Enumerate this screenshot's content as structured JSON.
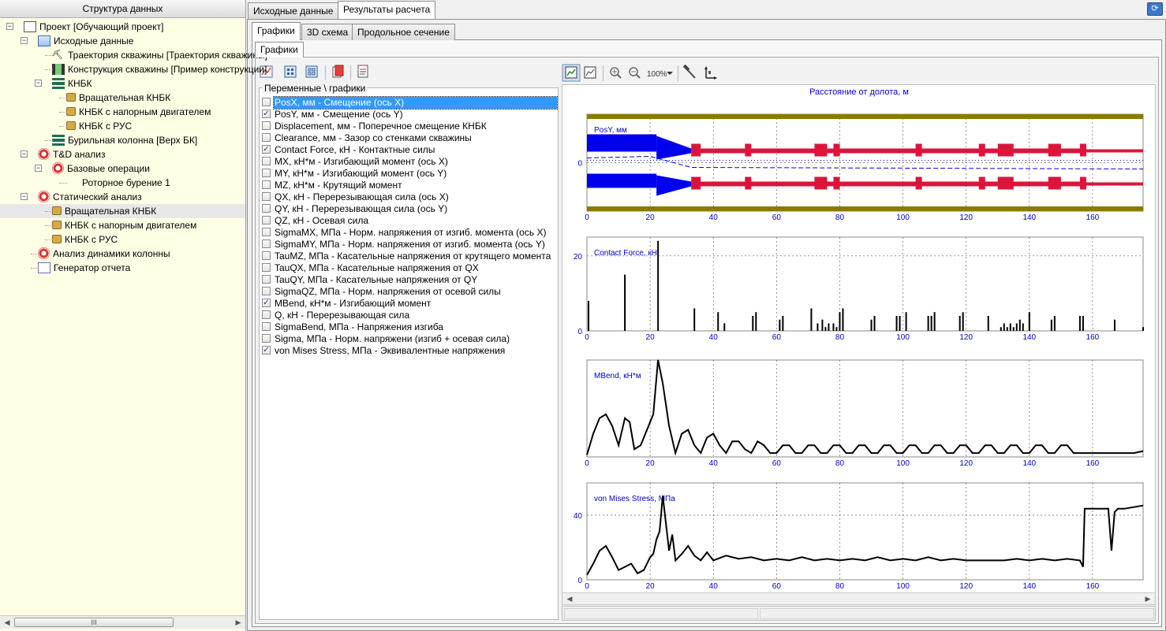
{
  "left_panel": {
    "title": "Структура данных",
    "tree": [
      {
        "label": "Проект [Обучающий проект]",
        "icon": "project-icon",
        "level": 0,
        "expander": "minus"
      },
      {
        "label": "Исходные данные",
        "icon": "source-data-icon",
        "level": 1,
        "expander": "minus"
      },
      {
        "label": "Траектория скважины [Траектория скважины]",
        "icon": "trajectory-icon",
        "level": 2
      },
      {
        "label": "Конструкция скважины [Пример конструкции]",
        "icon": "well-construction-icon",
        "level": 2
      },
      {
        "label": "КНБК",
        "icon": "bha-icon",
        "level": 2,
        "expander": "minus"
      },
      {
        "label": "Вращательная КНБК",
        "icon": "lock-icon",
        "level": 3
      },
      {
        "label": "КНБК с напорным двигателем",
        "icon": "lock-icon",
        "level": 3
      },
      {
        "label": "КНБК с РУС",
        "icon": "lock-icon",
        "level": 3
      },
      {
        "label": "Бурильная колонна [Верх БК]",
        "icon": "drill-string-icon",
        "level": 2
      },
      {
        "label": "T&D анализ",
        "icon": "td-analysis-icon",
        "level": 1,
        "expander": "minus"
      },
      {
        "label": "Базовые операции",
        "icon": "base-operations-icon",
        "level": 2,
        "expander": "minus"
      },
      {
        "label": "Роторное бурение 1",
        "icon": "rotary-drilling-icon",
        "level": 3
      },
      {
        "label": "Статический анализ",
        "icon": "static-analysis-icon",
        "level": 1,
        "expander": "minus"
      },
      {
        "label": "Вращательная КНБК",
        "icon": "lock-icon",
        "level": 2,
        "selected": true
      },
      {
        "label": "КНБК с напорным двигателем",
        "icon": "lock-icon",
        "level": 2
      },
      {
        "label": "КНБК с РУС",
        "icon": "lock-icon",
        "level": 2
      },
      {
        "label": "Анализ динамики колонны",
        "icon": "dynamics-analysis-icon",
        "level": 1
      },
      {
        "label": "Генератор отчета",
        "icon": "report-generator-icon",
        "level": 1
      }
    ],
    "scroll_grip": "III"
  },
  "tabs": {
    "main": [
      "Исходные данные",
      "Результаты расчета"
    ],
    "main_active": 1,
    "sub": [
      "Графики",
      "3D схема",
      "Продольное сечение"
    ],
    "sub_active": 0,
    "inner": "Графики"
  },
  "variables": {
    "group_title": "Переменные \\ графики",
    "items": [
      {
        "label": "PosX, мм - Смещение (ось X)",
        "checked": false,
        "selected": true
      },
      {
        "label": "PosY, мм - Смещение (ось Y)",
        "checked": true
      },
      {
        "label": "Displacement, мм - Поперечное смещение КНБК",
        "checked": false
      },
      {
        "label": "Clearance, мм - Зазор со стенками скважины",
        "checked": false
      },
      {
        "label": "Contact Force, кН - Контактные силы",
        "checked": true
      },
      {
        "label": "MX, кН*м - Изгибающий момент (ось X)",
        "checked": false
      },
      {
        "label": "MY, кН*м - Изгибающий момент (ось Y)",
        "checked": false
      },
      {
        "label": "MZ, кН*м - Крутящий момент",
        "checked": false
      },
      {
        "label": "QX, кН - Перерезывающая сила (ось X)",
        "checked": false
      },
      {
        "label": "QY, кН - Перерезывающая сила (ось Y)",
        "checked": false
      },
      {
        "label": "QZ, кН - Осевая сила",
        "checked": false
      },
      {
        "label": "SigmaMX, МПа - Норм. напряжения от изгиб. момента (ось X)",
        "checked": false
      },
      {
        "label": "SigmaMY, МПа - Норм. напряжения от изгиб. момента (ось Y)",
        "checked": false
      },
      {
        "label": "TauMZ, МПа - Касательные напряжения от крутящего момента",
        "checked": false
      },
      {
        "label": "TauQX, МПа - Касательные напряжения от QX",
        "checked": false
      },
      {
        "label": "TauQY, МПа - Касательные напряжения от QY",
        "checked": false
      },
      {
        "label": "SigmaQZ, МПа - Норм. напряжения от осевой силы",
        "checked": false
      },
      {
        "label": "MBend, кН*м - Изгибающий момент",
        "checked": true
      },
      {
        "label": "Q, кН - Перерезывающая сила",
        "checked": false
      },
      {
        "label": "SigmaBend, МПа - Напряжения изгиба",
        "checked": false
      },
      {
        "label": "Sigma, МПа - Норм. напряжени (изгиб + осевая сила)",
        "checked": false
      },
      {
        "label": "von Mises Stress, МПа - Эквивалентные напряжения",
        "checked": true
      }
    ]
  },
  "plot_toolbar": {
    "zoom_label": "100%",
    "icons": [
      "chart-settings-icon",
      "chart-export-icon",
      "zoom-in-icon",
      "zoom-out-icon",
      "zoom-level-icon",
      "hammer-icon",
      "axis-icon"
    ]
  },
  "colors": {
    "tree_bg": "#ffffe6",
    "well_wall": "#8c7a00",
    "string_blue": "#0000ee",
    "string_red": "#dc143c",
    "plot_line": "#000000",
    "axis_text": "#0000cc"
  },
  "chart_data": {
    "x_axis_title": "Расстояние от долота, м",
    "x_ticks": [
      0,
      20,
      40,
      60,
      80,
      100,
      120,
      140,
      160
    ],
    "xlim": [
      0,
      176
    ],
    "plots": [
      {
        "type": "area",
        "name": "PosY, мм",
        "y_ticks": [
          0
        ],
        "grid": true
      },
      {
        "type": "bar",
        "name": "Contact Force, кН",
        "y_ticks": [
          0,
          20
        ],
        "ylim": [
          0,
          25
        ],
        "x": [
          0.5,
          12,
          22.5,
          34,
          41.5,
          43.5,
          52.5,
          53.5,
          61,
          62,
          71,
          73,
          74.5,
          75.5,
          76.5,
          78,
          79,
          80,
          81,
          90,
          91,
          98,
          99,
          101,
          108,
          109,
          110,
          118,
          119,
          127,
          131,
          132,
          133,
          134,
          135,
          136,
          137,
          138,
          140,
          147,
          148,
          156,
          157,
          167,
          176
        ],
        "values": [
          8,
          15,
          24,
          6,
          5,
          2,
          4,
          5,
          3,
          4,
          6,
          2,
          3,
          1,
          2,
          2,
          1,
          5,
          6,
          3,
          4,
          4,
          4,
          5,
          4,
          4,
          5,
          4,
          5,
          4,
          1,
          2,
          1,
          2,
          1,
          2,
          3,
          2,
          5,
          3,
          4,
          4,
          4,
          3,
          1
        ],
        "grid": true
      },
      {
        "type": "line",
        "name": "MBend, кН*м",
        "ylim": [
          0,
          25
        ],
        "x": [
          0,
          2,
          4,
          6,
          8,
          10,
          12,
          13.5,
          15,
          17,
          19,
          21,
          22.5,
          24,
          26,
          28,
          30,
          32,
          34,
          36,
          38,
          40,
          42,
          44,
          46,
          48,
          50,
          52,
          54,
          56,
          58,
          60,
          62,
          64,
          66,
          68,
          70,
          72,
          74,
          76,
          78,
          80,
          82,
          84,
          86,
          88,
          90,
          92,
          94,
          96,
          98,
          100,
          102,
          104,
          106,
          108,
          110,
          112,
          114,
          116,
          118,
          120,
          122,
          124,
          126,
          128,
          130,
          132,
          134,
          136,
          138,
          140,
          142,
          144,
          146,
          148,
          150,
          152,
          154,
          156,
          158,
          160,
          162,
          164,
          166,
          167,
          170,
          173,
          176
        ],
        "values": [
          0.5,
          6,
          10,
          11,
          8,
          3,
          10,
          9,
          2,
          3,
          7,
          11,
          25,
          19,
          8,
          1,
          6,
          7,
          3,
          1,
          5,
          6,
          3,
          1,
          4,
          4,
          2,
          1,
          4,
          3,
          1,
          1,
          3,
          3,
          1,
          1,
          3,
          3,
          1,
          1,
          3,
          3,
          1,
          1,
          3,
          3,
          1,
          1,
          3,
          3,
          1,
          1,
          3,
          3,
          1,
          1,
          3,
          3,
          1,
          1,
          3,
          3,
          1,
          1,
          3,
          3,
          1,
          1,
          3,
          3,
          1,
          1,
          3,
          3,
          1,
          1,
          3,
          3,
          1,
          1,
          1,
          1,
          1,
          1,
          1,
          1,
          1,
          1,
          1.5
        ],
        "grid": true
      },
      {
        "type": "line",
        "name": "von Mises Stress, МПа",
        "y_ticks": [
          0,
          40
        ],
        "ylim": [
          0,
          60
        ],
        "x": [
          0,
          2,
          4,
          6,
          8,
          10,
          12,
          14,
          16,
          18,
          20,
          21,
          22,
          23,
          24,
          25,
          26,
          27,
          28,
          30,
          32,
          34,
          36,
          38,
          40,
          44,
          48,
          52,
          56,
          60,
          64,
          68,
          72,
          76,
          80,
          84,
          88,
          92,
          96,
          100,
          104,
          108,
          112,
          116,
          120,
          124,
          128,
          132,
          136,
          140,
          144,
          148,
          152,
          156,
          157,
          157.5,
          165,
          166,
          167,
          168,
          170,
          176
        ],
        "values": [
          3,
          10,
          18,
          21,
          14,
          6,
          8,
          10,
          4,
          6,
          14,
          16,
          25,
          30,
          52,
          35,
          18,
          28,
          12,
          16,
          21,
          15,
          12,
          17,
          12,
          15,
          13,
          14,
          12,
          13,
          12,
          14,
          12,
          13,
          12,
          13,
          12,
          14,
          12,
          13,
          12,
          14,
          12,
          13,
          12,
          12,
          12,
          12,
          13,
          12,
          13,
          12,
          13,
          12,
          8,
          44,
          44,
          18,
          42,
          44,
          44,
          46
        ],
        "grid": true
      }
    ]
  }
}
